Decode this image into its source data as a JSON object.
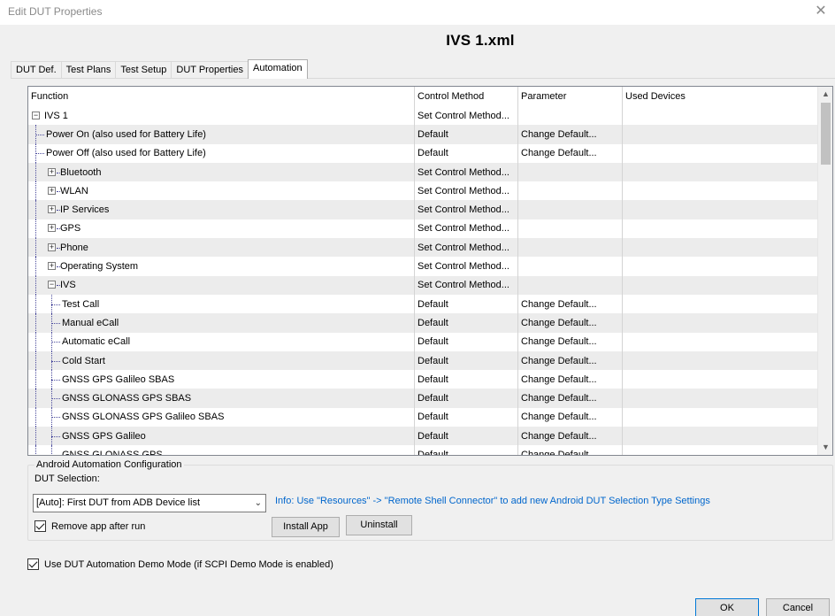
{
  "window": {
    "title": "Edit DUT Properties"
  },
  "file_title": "IVS 1.xml",
  "tabs": [
    "DUT Def.",
    "Test Plans",
    "Test Setup",
    "DUT Properties",
    "Automation"
  ],
  "active_tab": "Automation",
  "grid": {
    "columns": [
      "Function",
      "Control Method",
      "Parameter",
      "Used Devices"
    ],
    "rows": [
      {
        "label": "IVS 1",
        "control": "Set Control Method...",
        "param": "",
        "level": 0,
        "expander": "minus"
      },
      {
        "label": "Power On (also used for Battery Life)",
        "control": "Default",
        "param": "Change Default...",
        "level": 1,
        "expander": ""
      },
      {
        "label": "Power Off (also used for Battery Life)",
        "control": "Default",
        "param": "Change Default...",
        "level": 1,
        "expander": ""
      },
      {
        "label": "Bluetooth",
        "control": "Set Control Method...",
        "param": "",
        "level": 1,
        "expander": "plus"
      },
      {
        "label": "WLAN",
        "control": "Set Control Method...",
        "param": "",
        "level": 1,
        "expander": "plus"
      },
      {
        "label": "IP Services",
        "control": "Set Control Method...",
        "param": "",
        "level": 1,
        "expander": "plus"
      },
      {
        "label": "GPS",
        "control": "Set Control Method...",
        "param": "",
        "level": 1,
        "expander": "plus"
      },
      {
        "label": "Phone",
        "control": "Set Control Method...",
        "param": "",
        "level": 1,
        "expander": "plus"
      },
      {
        "label": "Operating System",
        "control": "Set Control Method...",
        "param": "",
        "level": 1,
        "expander": "plus"
      },
      {
        "label": "IVS",
        "control": "Set Control Method...",
        "param": "",
        "level": 1,
        "expander": "minus"
      },
      {
        "label": "Test Call",
        "control": "Default",
        "param": "Change Default...",
        "level": 2,
        "expander": ""
      },
      {
        "label": "Manual eCall",
        "control": "Default",
        "param": "Change Default...",
        "level": 2,
        "expander": ""
      },
      {
        "label": "Automatic eCall",
        "control": "Default",
        "param": "Change Default...",
        "level": 2,
        "expander": ""
      },
      {
        "label": "Cold Start",
        "control": "Default",
        "param": "Change Default...",
        "level": 2,
        "expander": ""
      },
      {
        "label": "GNSS GPS Galileo SBAS",
        "control": "Default",
        "param": "Change Default...",
        "level": 2,
        "expander": ""
      },
      {
        "label": "GNSS GLONASS GPS SBAS",
        "control": "Default",
        "param": "Change Default...",
        "level": 2,
        "expander": ""
      },
      {
        "label": "GNSS GLONASS GPS Galileo SBAS",
        "control": "Default",
        "param": "Change Default...",
        "level": 2,
        "expander": ""
      },
      {
        "label": "GNSS GPS Galileo",
        "control": "Default",
        "param": "Change Default...",
        "level": 2,
        "expander": ""
      },
      {
        "label": "GNSS GLONASS GPS",
        "control": "Default",
        "param": "Change Default...",
        "level": 2,
        "expander": ""
      }
    ]
  },
  "android": {
    "legend": "Android Automation Configuration",
    "dut_selection_label": "DUT Selection:",
    "dut_selection_value": "[Auto]: First DUT from ADB Device list",
    "info": "Info: Use \"Resources\" -> \"Remote Shell Connector\" to add new Android DUT Selection Type Settings",
    "remove_app_label": "Remove app after run",
    "remove_app_checked": true,
    "install_label": "Install App",
    "uninstall_label": "Uninstall"
  },
  "demo_mode_label": "Use DUT Automation Demo Mode (if SCPI Demo Mode is enabled)",
  "demo_mode_checked": true,
  "buttons": {
    "ok": "OK",
    "cancel": "Cancel"
  }
}
